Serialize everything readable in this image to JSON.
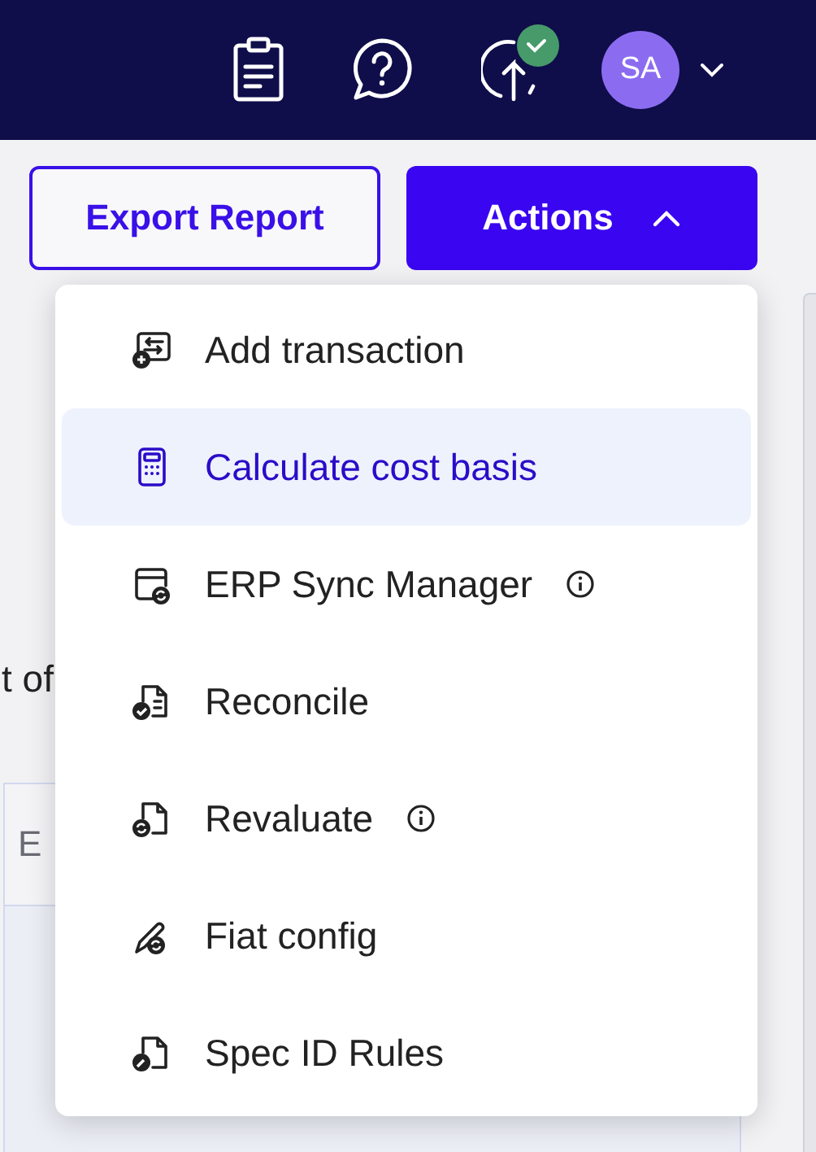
{
  "top_bar": {
    "avatar": {
      "initials": "SA"
    },
    "upload_status": {
      "synced": true
    }
  },
  "buttons": {
    "export": "Export Report",
    "actions": {
      "label": "Actions",
      "expanded": true
    }
  },
  "page": {
    "text_fragment": "t of",
    "table": {
      "column_1": "E"
    }
  },
  "actions_menu": [
    {
      "label": "Add transaction",
      "selected": false,
      "info": false
    },
    {
      "label": "Calculate cost basis",
      "selected": true,
      "info": false
    },
    {
      "label": "ERP Sync Manager",
      "selected": false,
      "info": true
    },
    {
      "label": "Reconcile",
      "selected": false,
      "info": false
    },
    {
      "label": "Revaluate",
      "selected": false,
      "info": true
    },
    {
      "label": "Fiat config",
      "selected": false,
      "info": false
    },
    {
      "label": "Spec ID Rules",
      "selected": false,
      "info": false
    }
  ]
}
